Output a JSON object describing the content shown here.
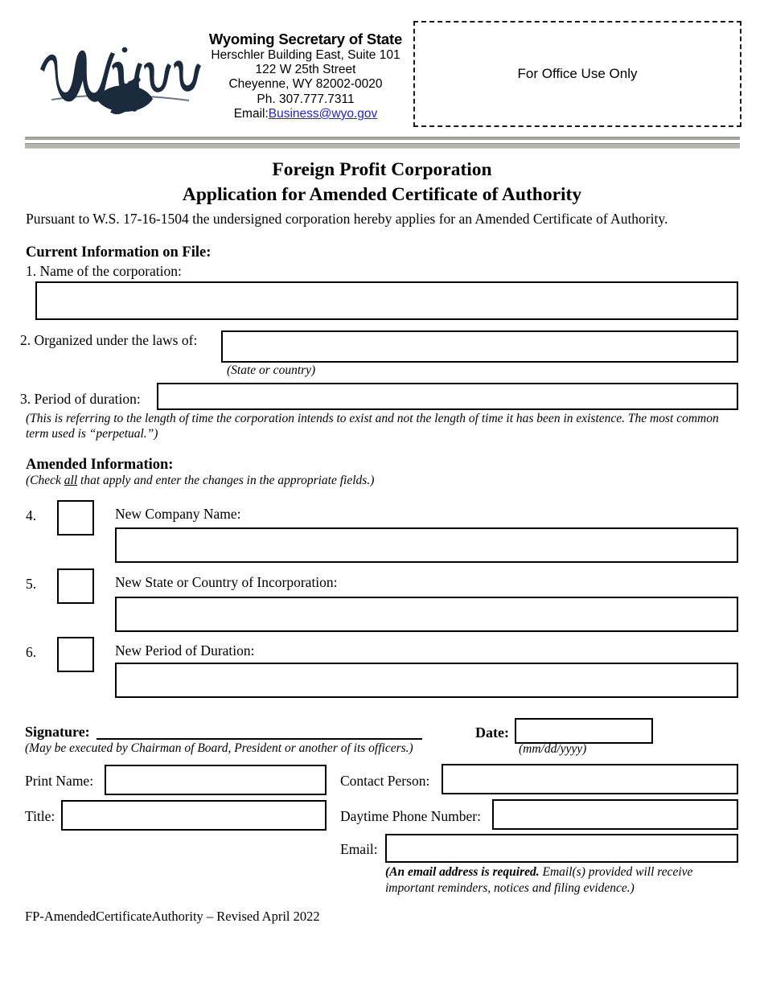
{
  "header": {
    "logo_alt": "wyoming-bucking-horse-logo",
    "agency_name": "Wyoming Secretary of State",
    "address_lines": [
      "Herschler Building East, Suite 101",
      "122 W 25th Street",
      "Cheyenne, WY 82002-0020",
      "Ph. 307.777.7311"
    ],
    "email_prefix": "Email:",
    "email_link": "Business@wyo.gov",
    "email_link_color": "#2222dd",
    "office_use_label": "For Office Use Only"
  },
  "title": {
    "line1": "Foreign Profit Corporation",
    "line2": "Application for Amended Certificate of Authority"
  },
  "intro": "Pursuant to W.S. 17-16-1504 the undersigned corporation hereby applies for an Amended Certificate of Authority.",
  "current_section": {
    "heading": "Current Information on File:",
    "fields": [
      {
        "number": "1.",
        "label": "1. Name of the corporation:",
        "value": "",
        "note": ""
      },
      {
        "number": "2.",
        "label": "2. Organized under the laws of:",
        "value": "",
        "note": "(State or country)"
      },
      {
        "number": "3.",
        "label": "3. Period of duration:",
        "value": "",
        "note": "(This is referring to the length of time the corporation intends to exist and not the length of time it has been in existence. The most common term used is “perpetual.”)"
      }
    ]
  },
  "amended_section": {
    "heading": "Amended Information:",
    "note_prefix": "(Check ",
    "note_underlined": "all",
    "note_suffix": " that apply and enter the changes in the appropriate fields.)",
    "rows": [
      {
        "number": "4.",
        "checked": false,
        "label": "New Company Name:",
        "value": ""
      },
      {
        "number": "5.",
        "checked": false,
        "label": "New State or Country of Incorporation:",
        "value": ""
      },
      {
        "number": "6.",
        "checked": false,
        "label": "New Period of Duration:",
        "value": ""
      }
    ]
  },
  "signature_section": {
    "signature_label": "Signature:",
    "signature_value": "",
    "signature_note": "(May be executed by Chairman of Board, President or another of its officers.)",
    "date_label": "Date:",
    "date_value": "",
    "date_note": "(mm/dd/yyyy)",
    "print_name_label": "Print Name:",
    "print_name_value": "",
    "title_label": "Title:",
    "title_value": "",
    "contact_person_label": "Contact Person:",
    "contact_person_value": "",
    "daytime_phone_label": "Daytime Phone Number:",
    "daytime_phone_value": "",
    "email_label": "Email:",
    "email_value": "",
    "email_note_bold": "(An email address is required.",
    "email_note_rest": " Email(s) provided will receive important reminders, notices and filing evidence.)"
  },
  "footer": "FP-AmendedCertificateAuthority – Revised April 2022"
}
